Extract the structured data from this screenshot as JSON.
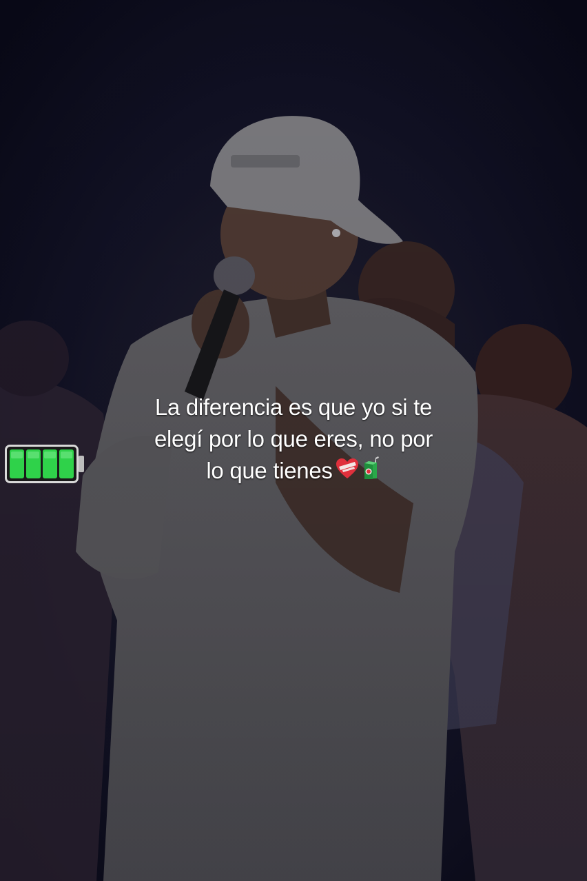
{
  "caption": {
    "lines": [
      "La diferencia es que yo si te",
      "elegí por lo que eres, no por",
      "lo que tienes"
    ]
  },
  "decorations": {
    "emojis": [
      "mending-heart-icon",
      "juice-box-icon"
    ],
    "battery": {
      "icon": "battery-full-icon",
      "level": 1.0,
      "segments": 4,
      "color": "#2fd24a"
    }
  },
  "colors": {
    "background": "#0c0c1c",
    "caption_text": "#ffffff",
    "battery_fill": "#2fd24a"
  }
}
